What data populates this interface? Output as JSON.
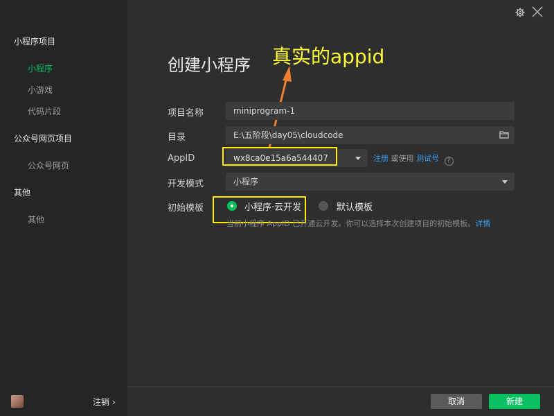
{
  "sidebar": {
    "sections": [
      {
        "title": "小程序项目",
        "items": [
          "小程序",
          "小游戏",
          "代码片段"
        ]
      },
      {
        "title": "公众号网页项目",
        "items": [
          "公众号网页"
        ]
      },
      {
        "title": "其他",
        "items": [
          "其他"
        ]
      }
    ],
    "active_item": "小程序",
    "logout_label": "注销",
    "logout_arrow": "›"
  },
  "page_title": "创建小程序",
  "annotation": {
    "text": "真实的appid",
    "color": "#ffff33"
  },
  "form": {
    "project_name": {
      "label": "项目名称",
      "value": "miniprogram-1"
    },
    "directory": {
      "label": "目录",
      "value": "E:\\五阶段\\day05\\cloudcode"
    },
    "appid": {
      "label": "AppID",
      "value": "wx8ca0e15a6a544407",
      "register_link": "注册",
      "or_text": "或使用",
      "test_link": "测试号",
      "help": "?"
    },
    "dev_mode": {
      "label": "开发模式",
      "value": "小程序"
    },
    "template": {
      "label": "初始模板",
      "options": [
        {
          "label": "小程序·云开发",
          "selected": true
        },
        {
          "label": "默认模板",
          "selected": false
        }
      ],
      "hint": "当前小程序 AppID 已开通云开发。你可以选择本次创建项目的初始模板。",
      "hint_link": "详情"
    }
  },
  "footer": {
    "cancel_label": "取消",
    "create_label": "新建"
  },
  "colors": {
    "accent": "#07c160",
    "link": "#3a9cf0",
    "highlight": "#ffee00",
    "arrow": "#f08030"
  },
  "icons": [
    "gear-icon",
    "close-icon",
    "folder-icon",
    "dropdown-arrow-icon",
    "help-icon"
  ]
}
